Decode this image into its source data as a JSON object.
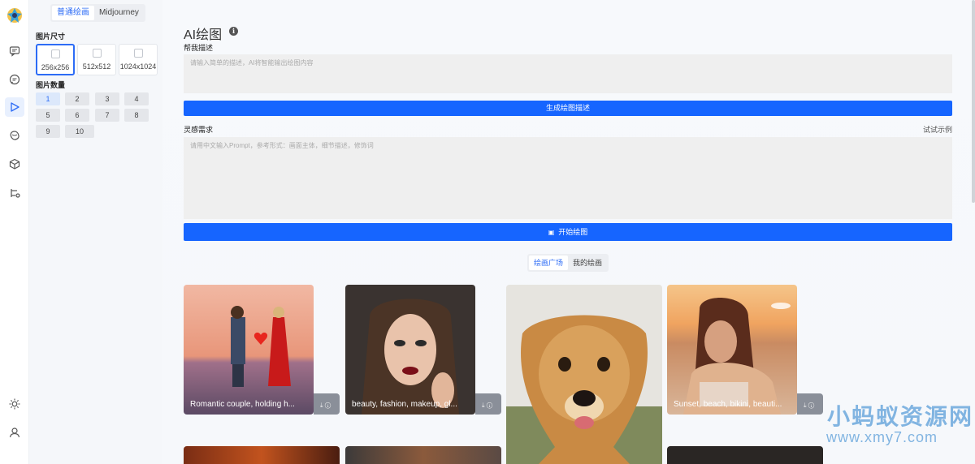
{
  "rail": {
    "icons": [
      "app-logo",
      "chat-icon",
      "message-icon",
      "draw-icon",
      "brain-icon",
      "cube-icon",
      "flow-icon",
      "theme-icon",
      "user-icon"
    ],
    "accent": "#2d6cf6"
  },
  "panel": {
    "mode_tabs": [
      "普通绘画",
      "Midjourney"
    ],
    "size_label": "图片尺寸",
    "sizes": [
      "256x256",
      "512x512",
      "1024x1024"
    ],
    "count_label": "图片数量",
    "counts": [
      "1",
      "2",
      "3",
      "4",
      "5",
      "6",
      "7",
      "8",
      "9",
      "10"
    ]
  },
  "main": {
    "title": "AI绘图",
    "help_label": "帮我描述",
    "help_placeholder": "请输入简单的描述，AI将智能输出绘图内容",
    "gen_button": "生成绘图描述",
    "inspire_label": "灵感需求",
    "example_link": "试试示例",
    "prompt_placeholder": "请用中文输入Prompt，参考形式：画面主体，细节描述，修饰词",
    "start_button": "开始绘图",
    "gallery_tabs": [
      "绘画广场",
      "我的绘画"
    ],
    "button_color": "#1665ff"
  },
  "gallery": [
    {
      "caption": "Romantic couple, holding h...",
      "icons": "⤓ ⓘ"
    },
    {
      "caption": "beauty, fashion, makeup, gl...",
      "icons": "⤓ ⓘ"
    },
    {
      "caption": "",
      "icons": ""
    },
    {
      "caption": "Sunset, beach, bikini, beauti...",
      "icons": "⤓ ⓘ"
    }
  ],
  "watermark": {
    "line1": "小蚂蚁资源网",
    "line2": "www.xmy7.com"
  }
}
